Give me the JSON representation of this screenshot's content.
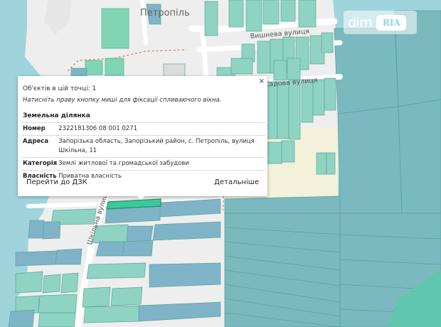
{
  "map": {
    "village_label": "Петропіль",
    "streets": {
      "vyshneva": "Вишнева вулиця",
      "sadova": "Садова вулиця",
      "shkilna": "Шкільна вулиця"
    },
    "colors": {
      "water": "#9fd4dc",
      "land": "#eeeeee",
      "road": "#ffffff",
      "parcel_teal": "#8fd3c3",
      "parcel_blue": "#7fb3c8",
      "parcel_green": "#6ad6a8",
      "parcel_field": "#7ab9be",
      "highlight": "#3ec89a",
      "sand": "#f3f1d9"
    }
  },
  "watermark": {
    "text": "dim",
    "badge": "RIA"
  },
  "popup": {
    "close_label": "×",
    "objects_count": "Об'єктів в цій точці: 1",
    "hint": "Натисніть праву кнопку миші для фіксації спливаючого вікна.",
    "heading": "Земельна ділянка",
    "rows": [
      {
        "key": "Номер",
        "value": "2322181306 08 001 0271"
      },
      {
        "key": "Адреса",
        "value": "Запорізька область, Запорізький район, с. Петропіль, вулиця Шкільна, 11"
      },
      {
        "key": "Категорія",
        "value": "Землі житлової та громадської забудови"
      },
      {
        "key": "Власність",
        "value": "Приватна власність"
      }
    ],
    "link_dzk": "Перейти до ДЗК",
    "link_details": "Детальніше"
  }
}
